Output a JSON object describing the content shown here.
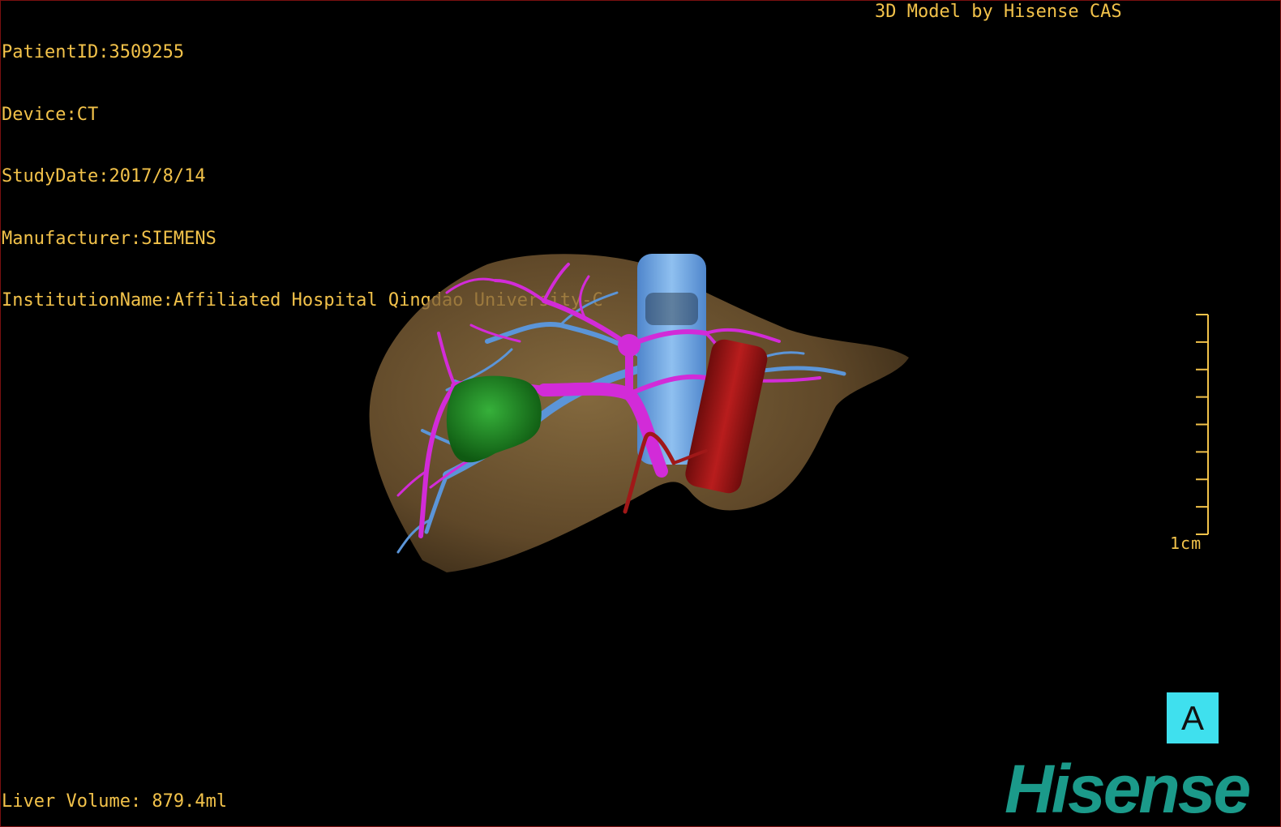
{
  "study_info": {
    "patient_id": "PatientID:3509255",
    "device": "Device:CT",
    "study_date": "StudyDate:2017/8/14",
    "manufacturer": "Manufacturer:SIEMENS",
    "institution": "InstitutionName:Affiliated Hospital Qingdao University-C"
  },
  "credit": "3D Model by Hisense CAS",
  "liver_volume": "Liver Volume: 879.4ml",
  "scale": {
    "label": "1cm",
    "ticks": 9
  },
  "orientation_label": "A",
  "logo_text": "Hisense",
  "colors": {
    "overlay_text": "#f2c24a",
    "liver": "#8a6a40",
    "portal_vein": "#d22bd8",
    "hepatic_vein": "#5b95d8",
    "tumor": "#1e8a1e",
    "artery": "#9a1515",
    "orientation_cube": "#3fe0ee",
    "logo": "#1b9a8a"
  },
  "model_structures": [
    "liver",
    "portal-vein",
    "hepatic-vein",
    "tumor",
    "artery"
  ]
}
